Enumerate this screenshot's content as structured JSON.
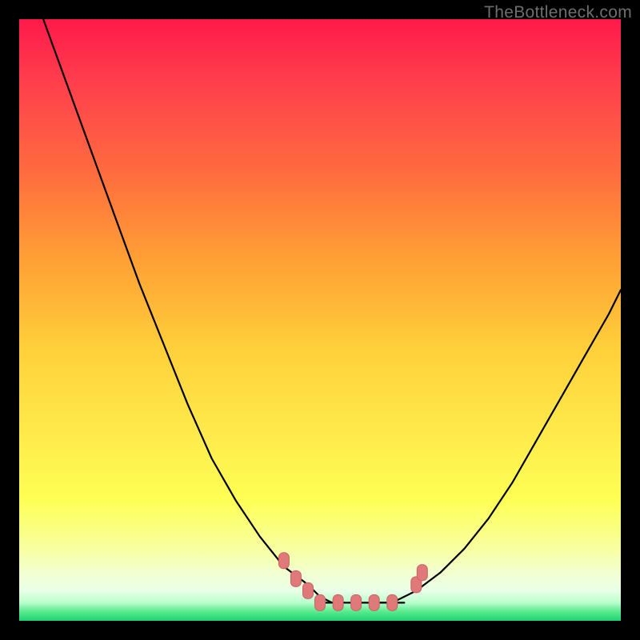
{
  "watermark": "TheBottleneck.com",
  "colors": {
    "gradient_top": "#ff1a4a",
    "gradient_mid": "#ffe94a",
    "gradient_bottom": "#1fd474",
    "frame": "#000000",
    "curve": "#000000",
    "marker_fill": "#e07a7a",
    "marker_stroke": "#c96262"
  },
  "chart_data": {
    "type": "line",
    "title": "",
    "xlabel": "",
    "ylabel": "",
    "xlim": [
      0,
      100
    ],
    "ylim": [
      0,
      100
    ],
    "grid": false,
    "legend": false,
    "series": [
      {
        "name": "left-branch",
        "x": [
          4,
          8,
          12,
          16,
          20,
          24,
          28,
          32,
          36,
          40,
          44,
          48,
          50,
          52,
          54
        ],
        "y": [
          100,
          89,
          78,
          67,
          56,
          46,
          36,
          27,
          20,
          14,
          9,
          6,
          4,
          3,
          3
        ]
      },
      {
        "name": "right-branch",
        "x": [
          60,
          62,
          64,
          66,
          70,
          74,
          78,
          82,
          86,
          90,
          94,
          98,
          100
        ],
        "y": [
          3,
          3,
          4,
          5,
          8,
          12,
          17,
          23,
          30,
          37,
          44,
          51,
          55
        ]
      },
      {
        "name": "flat-min",
        "x": [
          50,
          52,
          54,
          56,
          58,
          60,
          62,
          64
        ],
        "y": [
          3,
          3,
          3,
          3,
          3,
          3,
          3,
          3
        ]
      }
    ],
    "markers": [
      {
        "x": 44,
        "y": 10
      },
      {
        "x": 46,
        "y": 7
      },
      {
        "x": 48,
        "y": 5
      },
      {
        "x": 50,
        "y": 3
      },
      {
        "x": 53,
        "y": 3
      },
      {
        "x": 56,
        "y": 3
      },
      {
        "x": 59,
        "y": 3
      },
      {
        "x": 62,
        "y": 3
      },
      {
        "x": 66,
        "y": 6
      },
      {
        "x": 67,
        "y": 8
      }
    ]
  }
}
